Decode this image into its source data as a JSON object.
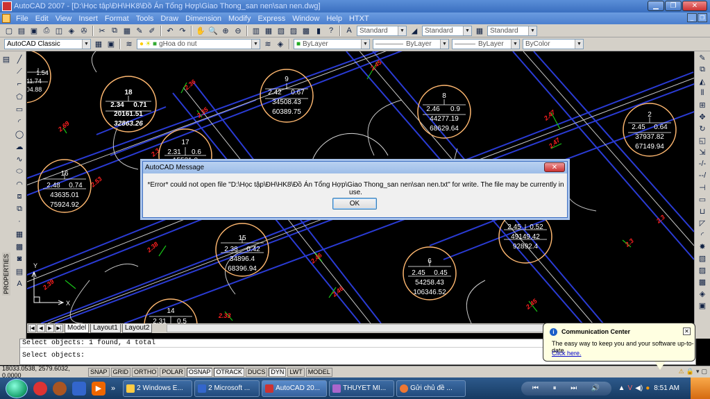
{
  "window": {
    "title": "AutoCAD 2007 - [D:\\Học tập\\ĐH\\HK8\\Đồ Án Tổng Hợp\\Giao Thong_san nen\\san nen.dwg]"
  },
  "menu": [
    "File",
    "Edit",
    "View",
    "Insert",
    "Format",
    "Tools",
    "Draw",
    "Dimension",
    "Modify",
    "Express",
    "Window",
    "Help",
    "HTXT"
  ],
  "toolbar1": {
    "text_style": "Standard",
    "dim_style": "Standard",
    "table_style": "Standard"
  },
  "toolbar2": {
    "workspace": "AutoCAD Classic",
    "layer": "gHoa do nut",
    "color": "ByLayer",
    "linetype": "ByLayer",
    "lineweight": "ByLayer",
    "plotstyle": "ByColor"
  },
  "left_panel": {
    "label": "PROPERTIES"
  },
  "drawing": {
    "lots": [
      {
        "id": "9",
        "a": "1.54",
        "b": "",
        "c": "11.74",
        "d": "04.88",
        "partial": true
      },
      {
        "id": "18",
        "a": "2.34",
        "b": "0.71",
        "c": "20161.51",
        "d": "32863.26",
        "bold": true
      },
      {
        "id": "9",
        "a": "2.42",
        "b": "0.67",
        "c": "34508.43",
        "d": "60389.75"
      },
      {
        "id": "8",
        "a": "2.46",
        "b": "0.9",
        "c": "44277.19",
        "d": "68629.64"
      },
      {
        "id": "2",
        "a": "2.45",
        "b": "0.64",
        "c": "37937.82",
        "d": "67149.94"
      },
      {
        "id": "17",
        "a": "2.31",
        "b": "0.6",
        "c": "15531.0",
        "d": "",
        "partial": true
      },
      {
        "id": "16",
        "a": "2.48",
        "b": "0.74",
        "c": "43635.01",
        "d": "75924.92"
      },
      {
        "id": "",
        "a": "2.45",
        "b": "0.52",
        "c": "49149.42",
        "d": "92892.4"
      },
      {
        "id": "15",
        "a": "2.38",
        "b": "0.42",
        "c": "34896.4",
        "d": "68396.94"
      },
      {
        "id": "6",
        "a": "2.45",
        "b": "0.45",
        "c": "54258.43",
        "d": "106346.52"
      },
      {
        "id": "14",
        "a": "2.31",
        "b": "0.5",
        "c": "",
        "d": "",
        "partial": true
      }
    ],
    "elevations": [
      "2.45",
      "2.36",
      "2.33",
      "2.69",
      "2.35",
      "2.47",
      "2.47",
      "2.3",
      "2.53",
      "2.3",
      "2.38",
      "2.46",
      "2.46",
      "2.39",
      "2.33",
      "2.45",
      "2.3"
    ],
    "ucs_x": "X",
    "ucs_y": "Y"
  },
  "layout_tabs": [
    "Model",
    "Layout1",
    "Layout2"
  ],
  "command_lines": [
    "Select objects: 1 found, 4 total",
    "Select objects:"
  ],
  "status": {
    "coords": "18033.0538, 2579.6032, 0.0000",
    "buttons": [
      "SNAP",
      "GRID",
      "ORTHO",
      "POLAR",
      "OSNAP",
      "OTRACK",
      "DUCS",
      "DYN",
      "LWT",
      "MODEL"
    ]
  },
  "dialog": {
    "title": "AutoCAD Message",
    "message": "*Error* could not open file \"D:\\Học tập\\ĐH\\HK8\\Đồ Án Tổng Hợp\\Giao Thong_san nen\\san nen.txt\" for write. The file may be currently in use.",
    "ok": "OK",
    "close": "✕"
  },
  "comm_center": {
    "title": "Communication Center",
    "body": "The easy way to keep you and your software up-to-date.",
    "link": "Click here."
  },
  "taskbar": {
    "tasks": [
      "2 Windows E...",
      "2 Microsoft ...",
      "AutoCAD 20...",
      "THUYET MI...",
      "Gửi chủ đề ..."
    ],
    "clock": "8:51 AM",
    "more": "»"
  }
}
